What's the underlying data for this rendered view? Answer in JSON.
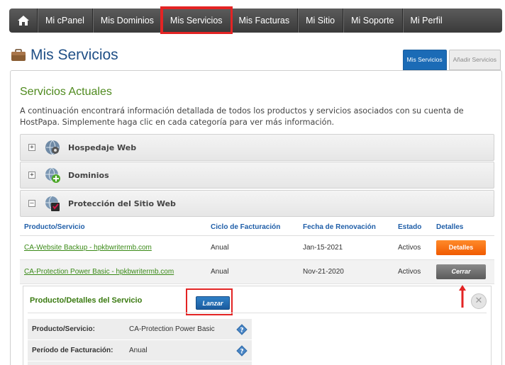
{
  "nav": {
    "items": [
      {
        "label": "Mi cPanel"
      },
      {
        "label": "Mis Dominios"
      },
      {
        "label": "Mis Servicios"
      },
      {
        "label": "Mis Facturas"
      },
      {
        "label": "Mi Sitio"
      },
      {
        "label": "Mi Soporte"
      },
      {
        "label": "Mi Perfil"
      }
    ]
  },
  "page": {
    "title": "Mis Servicios",
    "tabs": [
      {
        "label": "Mis Servicios"
      },
      {
        "label": "Añadir Servicios"
      }
    ]
  },
  "section": {
    "title": "Servicios Actuales",
    "intro": "A continuación encontrará información detallada de todos los productos y servicios asociados con su cuenta de HostPapa. Simplemente haga clic en cada categoría para ver más información."
  },
  "accordion": [
    {
      "toggle": "+",
      "label": "Hospedaje Web"
    },
    {
      "toggle": "+",
      "label": "Dominios"
    },
    {
      "toggle": "–",
      "label": "Protección del Sitio Web"
    }
  ],
  "table": {
    "headers": [
      "Producto/Servicio",
      "Ciclo de Facturación",
      "Fecha de Renovación",
      "Estado",
      "Detalles"
    ],
    "rows": [
      {
        "product": "CA-Website Backup - hpkbwritermb.com",
        "cycle": "Anual",
        "renewal": "Jan-15-2021",
        "status": "Activos",
        "button": "Detalles"
      },
      {
        "product": "CA-Protection Power Basic - hpkbwritermb.com",
        "cycle": "Anual",
        "renewal": "Nov-21-2020",
        "status": "Activos",
        "button": "Cerrar"
      }
    ]
  },
  "details": {
    "title": "Producto/Detalles del Servicio",
    "launch_label": "Lanzar",
    "close_glyph": "✕",
    "rows": [
      {
        "label": "Producto/Servicio:",
        "value": "CA-Protection Power Basic"
      },
      {
        "label": "Período de Facturación:",
        "value": "Anual"
      }
    ]
  },
  "colors": {
    "nav_bg": "#444444",
    "title_blue": "#1f4f86",
    "green": "#4f8a1e",
    "orange": "#f05a00",
    "highlight_red": "#e32424"
  }
}
